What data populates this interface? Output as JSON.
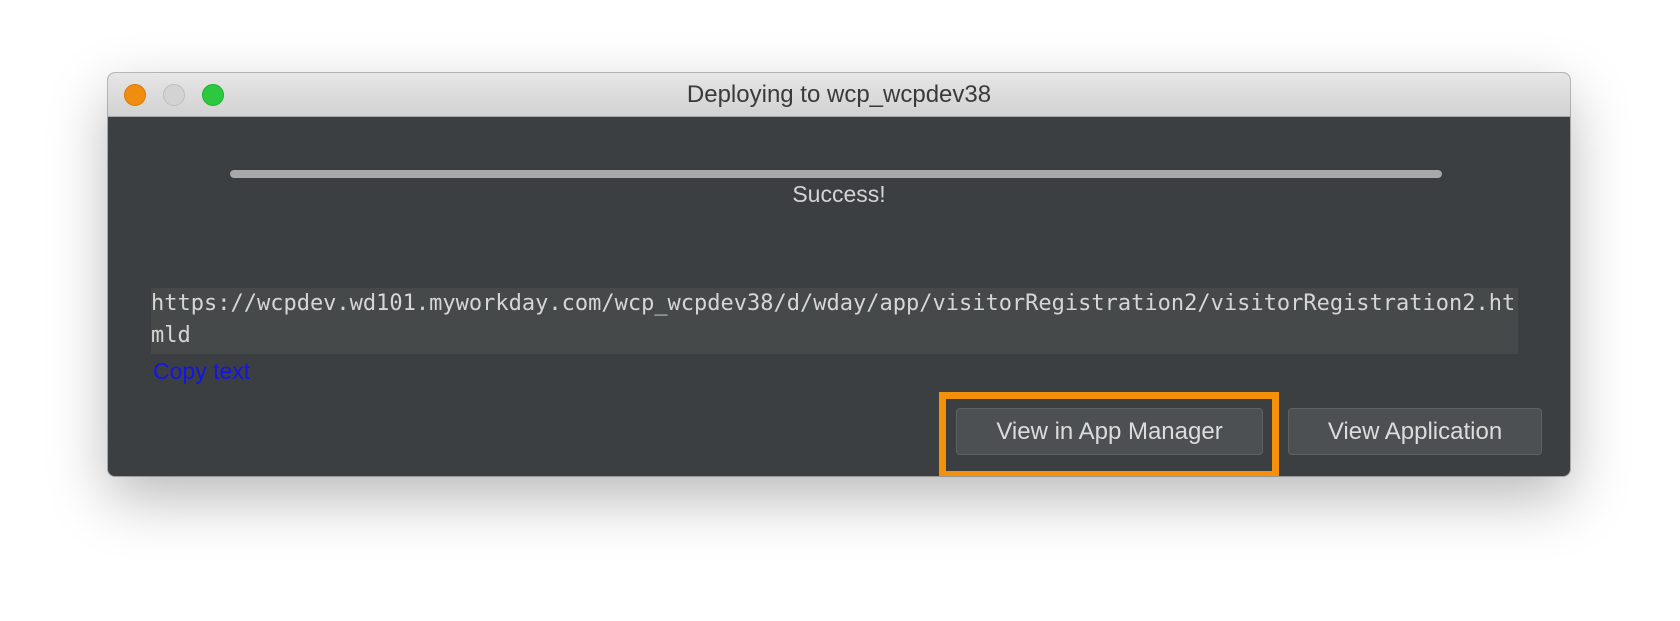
{
  "window": {
    "title": "Deploying to wcp_wcpdev38"
  },
  "titlebar_buttons": {
    "close_color": "#f08c10",
    "minimize_color": "#d3d3d3",
    "zoom_color": "#2bc840"
  },
  "progress": {
    "fraction": 1.0,
    "status": "Success!"
  },
  "result": {
    "url": "https://wcpdev.wd101.myworkday.com/wcp_wcpdev38/d/wday/app/visitorRegistration2/visitorRegistration2.htmld",
    "copy_label": "Copy text"
  },
  "actions": {
    "view_in_app_manager": "View in App Manager",
    "view_application": "View Application",
    "highlight_color": "#f5900a"
  }
}
